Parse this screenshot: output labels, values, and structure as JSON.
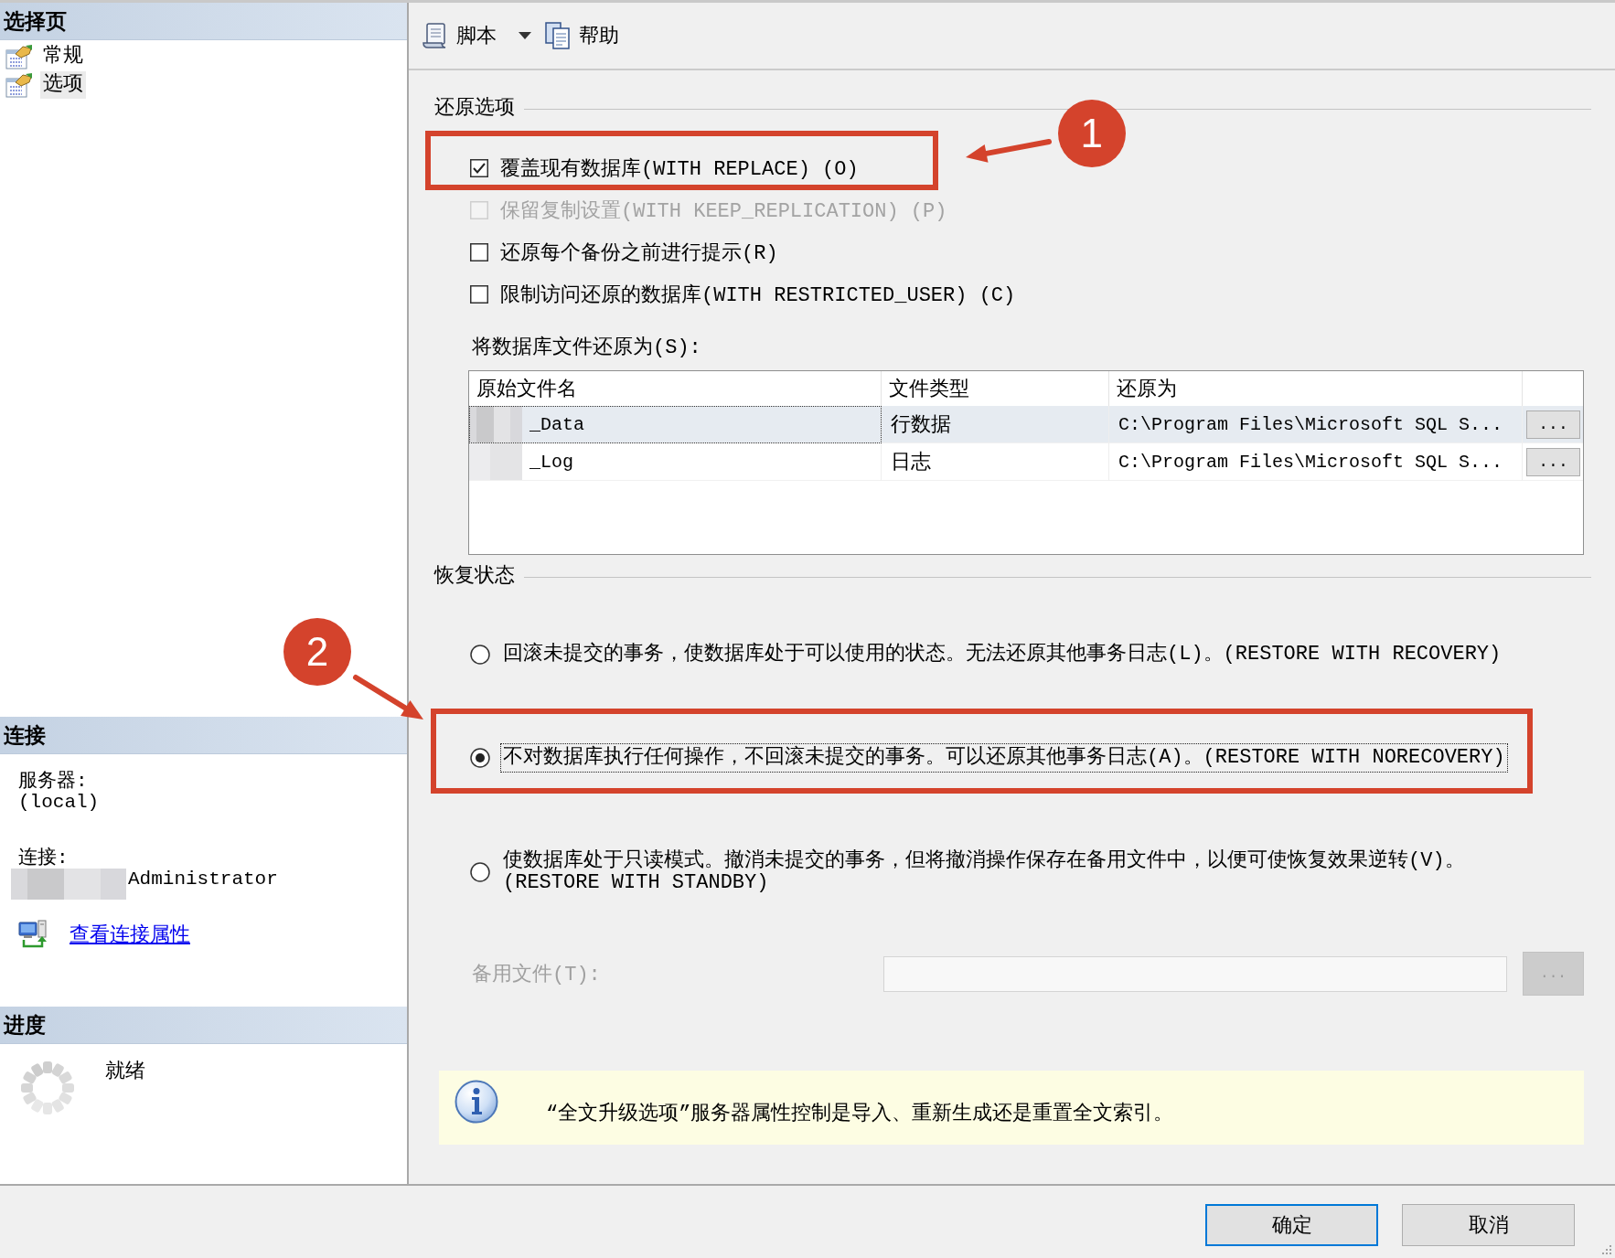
{
  "sidebar": {
    "pages_header": "选择页",
    "pages": [
      {
        "label": "常规",
        "selected": false
      },
      {
        "label": "选项",
        "selected": true
      }
    ],
    "connection_header": "连接",
    "connection": {
      "server_label": "服务器:",
      "server": "(local)",
      "connection_label": "连接:",
      "connection_value": "Administrator",
      "link": "查看连接属性"
    },
    "progress_header": "进度",
    "progress_status": "就绪"
  },
  "toolbar": [
    {
      "kind": "script",
      "label": "脚本",
      "dropdown": true
    },
    {
      "kind": "help",
      "label": "帮助",
      "dropdown": false
    }
  ],
  "restore_options": {
    "title": "还原选项",
    "options": [
      {
        "label": "覆盖现有数据库(WITH REPLACE) (O)",
        "checked": true,
        "disabled": false,
        "highlighted": true,
        "callout": "1"
      },
      {
        "label": "保留复制设置(WITH KEEP_REPLICATION) (P)",
        "checked": false,
        "disabled": true,
        "highlighted": false
      },
      {
        "label": "还原每个备份之前进行提示(R)",
        "checked": false,
        "disabled": false,
        "highlighted": false
      },
      {
        "label": "限制访问还原的数据库(WITH RESTRICTED_USER) (C)",
        "checked": false,
        "disabled": false,
        "highlighted": false
      }
    ]
  },
  "file_list": {
    "label": "将数据库文件还原为(S):",
    "columns": [
      "原始文件名",
      "文件类型",
      "还原为"
    ],
    "rows": [
      {
        "original_name": "_Data",
        "file_type": "行数据",
        "restore_as": "C:\\Program Files\\Microsoft SQL S...",
        "browse_button": "...",
        "selected": true
      },
      {
        "original_name": "_Log",
        "file_type": "日志",
        "restore_as": "C:\\Program Files\\Microsoft SQL S...",
        "browse_button": "...",
        "selected": false
      }
    ]
  },
  "recovery_state": {
    "title": "恢复状态",
    "options": [
      {
        "label": "回滚未提交的事务，使数据库处于可以使用的状态。无法还原其他事务日志(L)。(RESTORE WITH RECOVERY)",
        "selected": false,
        "highlighted": false
      },
      {
        "label": "不对数据库执行任何操作，不回滚未提交的事务。可以还原其他事务日志(A)。(RESTORE WITH NORECOVERY)",
        "selected": true,
        "highlighted": true,
        "callout": "2"
      },
      {
        "label": "使数据库处于只读模式。撤消未提交的事务，但将撤消操作保存在备用文件中，以便可使恢复效果逆转(V)。\n(RESTORE WITH STANDBY)",
        "selected": false,
        "highlighted": false
      }
    ]
  },
  "standby_file": {
    "label": "备用文件(T):",
    "disabled": true,
    "browse_button": "..."
  },
  "info_bar": {
    "text": "“全文升级选项”服务器属性控制是导入、重新生成还是重置全文索引。"
  },
  "buttons": [
    {
      "label": "确定",
      "default": true
    },
    {
      "label": "取消",
      "default": false
    }
  ]
}
